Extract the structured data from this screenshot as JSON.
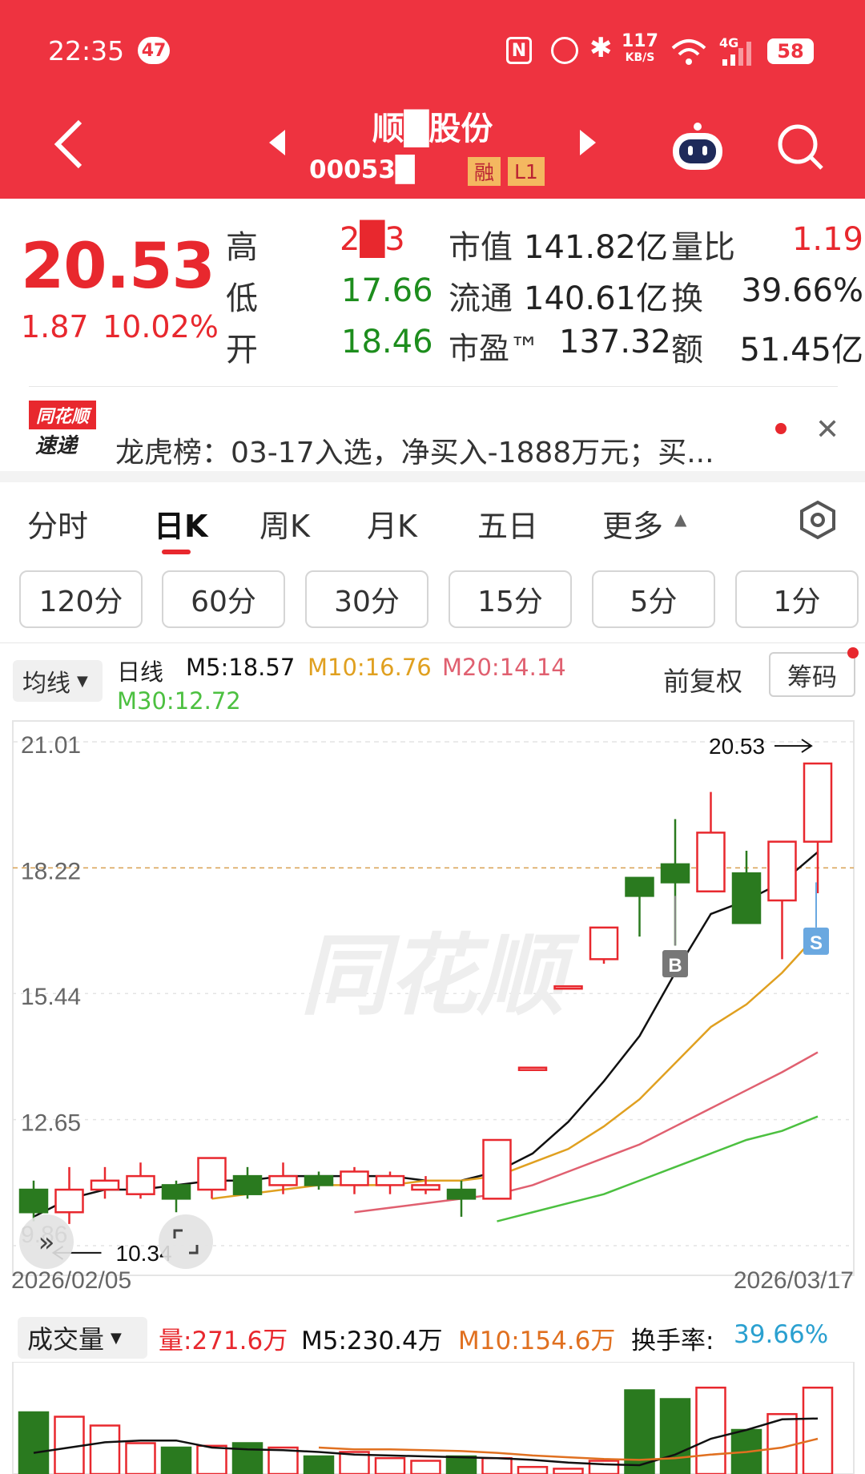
{
  "status_bar": {
    "time": "22:35",
    "notif_count": "47",
    "net_speed_top": "117",
    "net_speed_bottom": "KB/S",
    "signal": "4G",
    "battery": "58"
  },
  "header": {
    "stock_name": "顺█股份",
    "stock_code": "00053█",
    "tag_margin": "融",
    "tag_level": "L1"
  },
  "quote": {
    "price": "20.53",
    "change": "1.87",
    "change_pct": "10.02%",
    "high_label": "高",
    "high_value": "2█3",
    "low_label": "低",
    "low_value": "17.66",
    "open_label": "开",
    "open_value": "18.46",
    "mcap_label": "市值",
    "mcap_value": "141.82亿",
    "float_label": "流通",
    "float_value": "140.61亿",
    "pe_label": "市盈™",
    "pe_value": "137.32",
    "vol_ratio_label": "量比",
    "vol_ratio_value": "1.19",
    "turnover_label": "换",
    "turnover_value": "39.66%",
    "amount_label": "额",
    "amount_value": "51.45亿"
  },
  "news": {
    "logo_top": "同花顺",
    "logo_bottom": "速递",
    "text": "龙虎榜：03-17入选，净买入-1888万元；买..."
  },
  "tabs": [
    "分时",
    "日K",
    "周K",
    "月K",
    "五日",
    "更多"
  ],
  "active_tab": "日K",
  "periods": [
    "120分",
    "60分",
    "30分",
    "15分",
    "5分",
    "1分"
  ],
  "chart_header": {
    "ma_dropdown": "均线",
    "daily": "日线",
    "m5": "M5:18.57",
    "m10": "M10:16.76",
    "m20": "M20:14.14",
    "m30": "M30:12.72",
    "adjust": "前复权",
    "chips": "筹码"
  },
  "volume_header": {
    "label": "成交量",
    "vol": "量:271.6万",
    "m5": "M5:230.4万",
    "m10": "M10:154.6万",
    "turnover_label": "换手率:",
    "turnover_value": "39.66%"
  },
  "colors": {
    "header_red": "#ee3340",
    "up": "#e8282e",
    "down": "#2a7a1f",
    "m5": "#111111",
    "m10": "#e0a020",
    "m20": "#e06070",
    "m30": "#4cc040",
    "turnover": "#2aa0d0"
  },
  "chart_data": {
    "type": "candlestick",
    "y_ticks": [
      "21.01",
      "18.22",
      "15.44",
      "12.65",
      "9.86"
    ],
    "ylim": [
      9.86,
      21.01
    ],
    "start_date": "2026/02/05",
    "end_date": "2026/03/17",
    "high_marker": "20.53",
    "low_marker": "10.34",
    "watermark": "同花顺",
    "buy_marker": "B",
    "sell_marker": "S",
    "candles": [
      {
        "o": 11.1,
        "c": 10.6,
        "h": 11.3,
        "l": 10.4
      },
      {
        "o": 10.6,
        "c": 11.1,
        "h": 11.6,
        "l": 10.34
      },
      {
        "o": 11.1,
        "c": 11.3,
        "h": 11.6,
        "l": 10.9
      },
      {
        "o": 11.0,
        "c": 11.4,
        "h": 11.7,
        "l": 10.9
      },
      {
        "o": 11.2,
        "c": 10.9,
        "h": 11.3,
        "l": 10.6
      },
      {
        "o": 11.1,
        "c": 11.8,
        "h": 11.8,
        "l": 10.9
      },
      {
        "o": 11.4,
        "c": 11.0,
        "h": 11.6,
        "l": 10.9
      },
      {
        "o": 11.2,
        "c": 11.4,
        "h": 11.7,
        "l": 11.0
      },
      {
        "o": 11.4,
        "c": 11.2,
        "h": 11.5,
        "l": 11.1
      },
      {
        "o": 11.2,
        "c": 11.5,
        "h": 11.6,
        "l": 11.0
      },
      {
        "o": 11.2,
        "c": 11.4,
        "h": 11.5,
        "l": 11.0
      },
      {
        "o": 11.1,
        "c": 11.2,
        "h": 11.4,
        "l": 11.0
      },
      {
        "o": 11.1,
        "c": 10.9,
        "h": 11.3,
        "l": 10.5
      },
      {
        "o": 10.9,
        "c": 12.2,
        "h": 12.2,
        "l": 10.9
      },
      {
        "o": 13.8,
        "c": 13.8,
        "h": 13.8,
        "l": 13.8
      },
      {
        "o": 15.6,
        "c": 15.6,
        "h": 15.6,
        "l": 15.6
      },
      {
        "o": 16.2,
        "c": 16.9,
        "h": 16.9,
        "l": 16.1
      },
      {
        "o": 18.0,
        "c": 17.6,
        "h": 18.0,
        "l": 16.7
      },
      {
        "o": 18.3,
        "c": 17.9,
        "h": 19.3,
        "l": 16.5
      },
      {
        "o": 17.7,
        "c": 19.0,
        "h": 19.9,
        "l": 17.7
      },
      {
        "o": 18.1,
        "c": 17.0,
        "h": 18.6,
        "l": 17.0
      },
      {
        "o": 17.5,
        "c": 18.8,
        "h": 18.8,
        "l": 16.2
      },
      {
        "o": 18.8,
        "c": 20.53,
        "h": 20.53,
        "l": 17.66
      }
    ],
    "ma": {
      "M5": [
        10.5,
        10.9,
        11.1,
        11.1,
        11.2,
        11.3,
        11.3,
        11.4,
        11.4,
        11.4,
        11.4,
        11.3,
        11.3,
        11.5,
        11.9,
        12.6,
        13.5,
        14.5,
        15.9,
        17.2,
        17.5,
        17.9,
        18.57
      ],
      "M10": [
        null,
        null,
        null,
        null,
        null,
        10.9,
        11.0,
        11.1,
        11.2,
        11.2,
        11.2,
        11.3,
        11.3,
        11.4,
        11.7,
        12.0,
        12.5,
        13.1,
        13.9,
        14.7,
        15.2,
        15.9,
        16.76
      ],
      "M20": [
        null,
        null,
        null,
        null,
        null,
        null,
        null,
        null,
        null,
        10.6,
        10.7,
        10.8,
        10.9,
        11.0,
        11.2,
        11.5,
        11.8,
        12.1,
        12.5,
        12.9,
        13.3,
        13.7,
        14.14
      ],
      "M30": [
        null,
        null,
        null,
        null,
        null,
        null,
        null,
        null,
        null,
        null,
        null,
        null,
        null,
        10.4,
        10.6,
        10.8,
        11.0,
        11.3,
        11.6,
        11.9,
        12.2,
        12.4,
        12.72
      ]
    },
    "volume": [
      70,
      65,
      55,
      35,
      30,
      32,
      35,
      30,
      20,
      25,
      18,
      15,
      20,
      18,
      8,
      6,
      15,
      95,
      85,
      98,
      50,
      68,
      98
    ],
    "volume_m5": [
      24,
      30,
      36,
      38,
      38,
      30,
      28,
      27,
      25,
      22,
      21,
      20,
      19,
      18,
      16,
      13,
      11,
      10,
      22,
      40,
      50,
      62,
      63
    ],
    "volume_m10": [
      null,
      null,
      null,
      null,
      null,
      null,
      null,
      null,
      30,
      28,
      28,
      27,
      26,
      24,
      21,
      19,
      17,
      16,
      18,
      22,
      25,
      30,
      40
    ]
  }
}
